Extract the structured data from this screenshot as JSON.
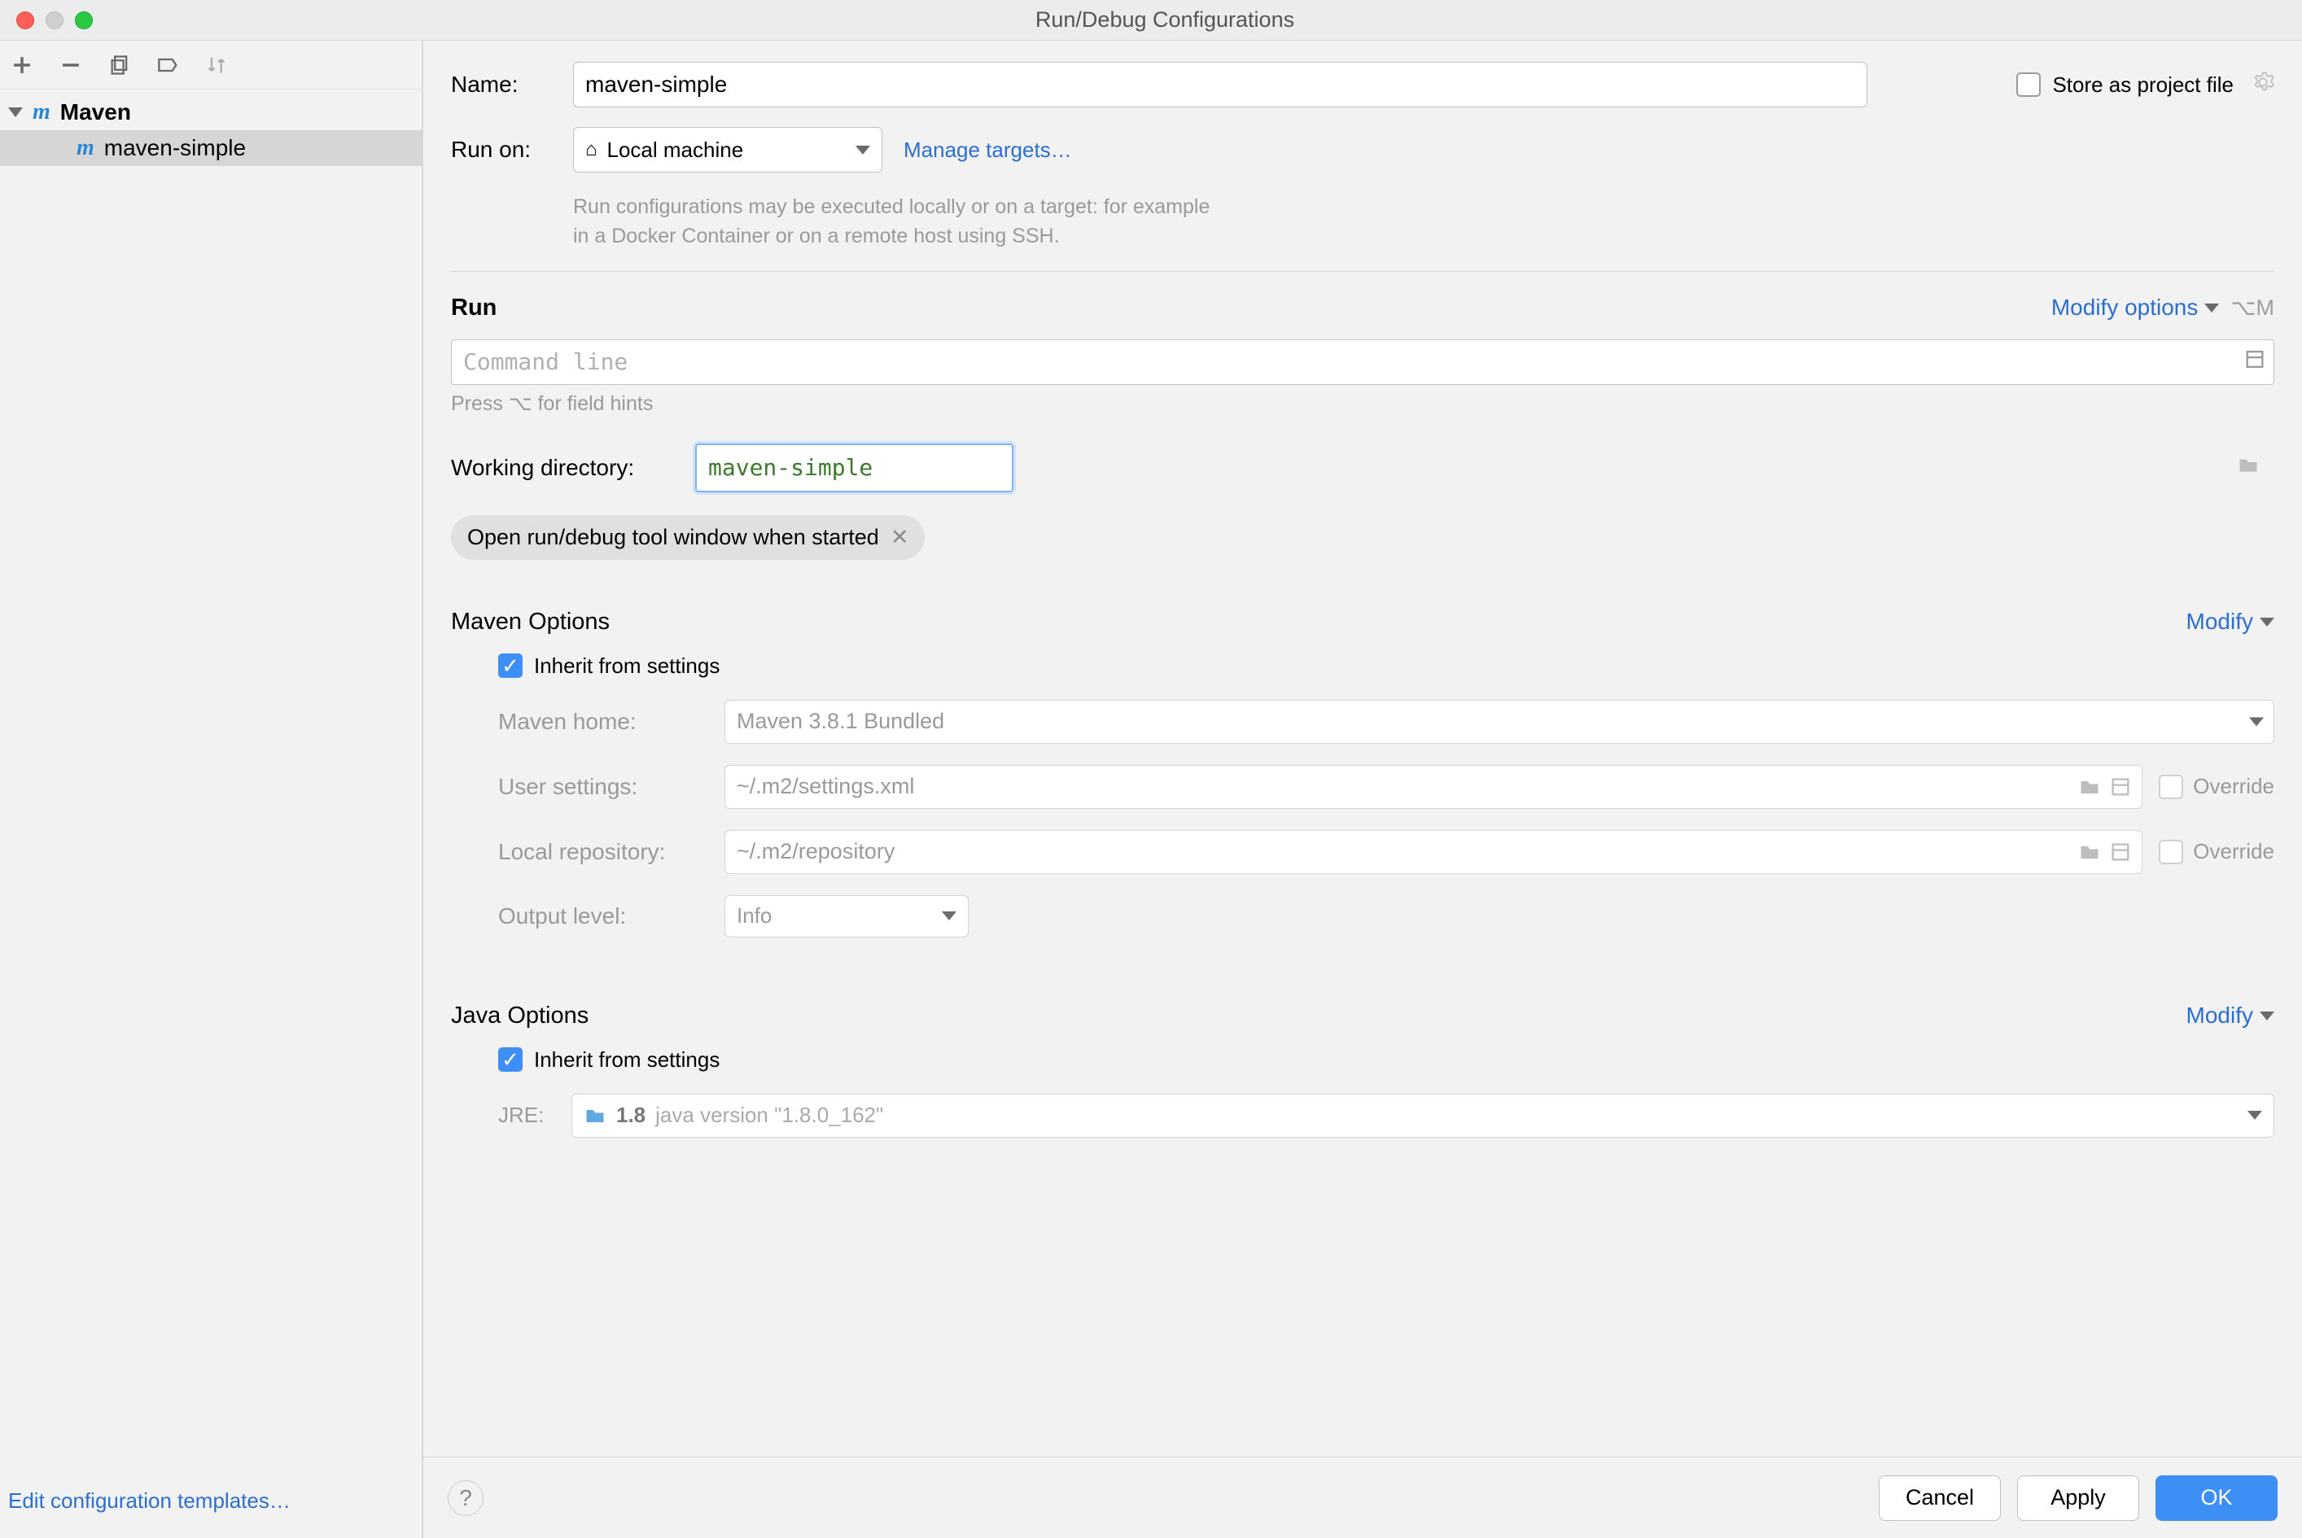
{
  "window": {
    "title": "Run/Debug Configurations"
  },
  "tree": {
    "root": "Maven",
    "item": "maven-simple"
  },
  "sidebar": {
    "edit_templates": "Edit configuration templates…"
  },
  "form": {
    "name_label": "Name:",
    "name_value": "maven-simple",
    "store_label": "Store as project file",
    "runon_label": "Run on:",
    "runon_value": "Local machine",
    "manage_targets": "Manage targets…",
    "runon_help1": "Run configurations may be executed locally or on a target: for example",
    "runon_help2": "in a Docker Container or on a remote host using SSH."
  },
  "run": {
    "header": "Run",
    "modify": "Modify options",
    "shortcut": "⌥M",
    "cmd_placeholder": "Command line",
    "hint": "Press ⌥ for field hints",
    "wd_label": "Working directory:",
    "wd_value": "maven-simple",
    "chip": "Open run/debug tool window when started"
  },
  "maven": {
    "header": "Maven Options",
    "modify": "Modify",
    "inherit": "Inherit from settings",
    "home_label": "Maven home:",
    "home_value": "Maven 3.8.1 Bundled",
    "user_label": "User settings:",
    "user_value": "~/.m2/settings.xml",
    "repo_label": "Local repository:",
    "repo_value": "~/.m2/repository",
    "override": "Override",
    "output_label": "Output level:",
    "output_value": "Info"
  },
  "java": {
    "header": "Java Options",
    "modify": "Modify",
    "inherit": "Inherit from settings",
    "jre_label": "JRE:",
    "jre_strong": "1.8",
    "jre_rest": "java version \"1.8.0_162\""
  },
  "footer": {
    "cancel": "Cancel",
    "apply": "Apply",
    "ok": "OK"
  }
}
